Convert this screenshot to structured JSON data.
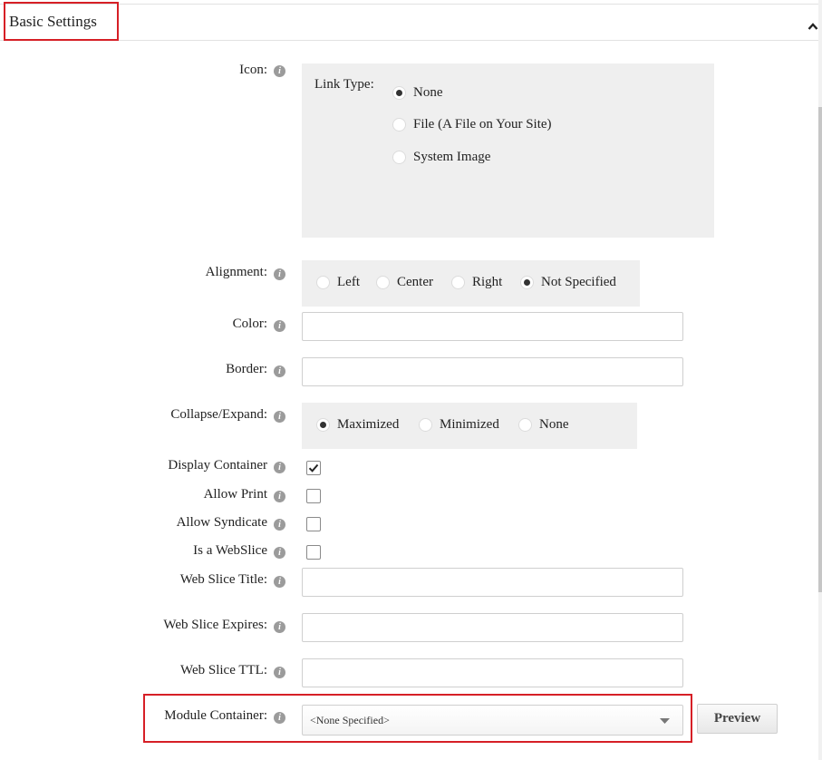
{
  "section": {
    "title": "Basic Settings",
    "expanded": true
  },
  "icon_field": {
    "label": "Icon:",
    "link_type_label": "Link Type:",
    "options": [
      {
        "label": "None",
        "selected": true
      },
      {
        "label": "File (A File on Your Site)",
        "selected": false
      },
      {
        "label": "System Image",
        "selected": false
      }
    ]
  },
  "alignment": {
    "label": "Alignment:",
    "options": [
      {
        "label": "Left",
        "selected": false
      },
      {
        "label": "Center",
        "selected": false
      },
      {
        "label": "Right",
        "selected": false
      },
      {
        "label": "Not Specified",
        "selected": true
      }
    ]
  },
  "color": {
    "label": "Color:",
    "value": ""
  },
  "border": {
    "label": "Border:",
    "value": ""
  },
  "collapse_expand": {
    "label": "Collapse/Expand:",
    "options": [
      {
        "label": "Maximized",
        "selected": true
      },
      {
        "label": "Minimized",
        "selected": false
      },
      {
        "label": "None",
        "selected": false
      }
    ]
  },
  "display_container": {
    "label": "Display Container",
    "checked": true
  },
  "allow_print": {
    "label": "Allow Print",
    "checked": false
  },
  "allow_syndicate": {
    "label": "Allow Syndicate",
    "checked": false
  },
  "is_webslice": {
    "label": "Is a WebSlice",
    "checked": false
  },
  "web_slice_title": {
    "label": "Web Slice Title:",
    "value": ""
  },
  "web_slice_expires": {
    "label": "Web Slice Expires:",
    "value": ""
  },
  "web_slice_ttl": {
    "label": "Web Slice TTL:",
    "value": ""
  },
  "module_container": {
    "label": "Module Container:",
    "selected": "<None Specified>",
    "preview_label": "Preview"
  },
  "info_icon_glyph": "i",
  "colors": {
    "highlight": "#d61f26",
    "panel": "#efefef"
  }
}
